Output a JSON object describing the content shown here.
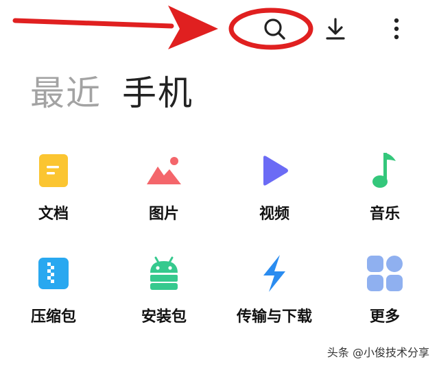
{
  "toolbar": {
    "search_icon": "search-icon",
    "download_icon": "download-icon",
    "more_icon": "more-vertical-icon"
  },
  "tabs": [
    {
      "label": "最近",
      "selected": false
    },
    {
      "label": "手机",
      "selected": true
    }
  ],
  "categories": [
    {
      "label": "文档",
      "icon": "document-icon",
      "color": "#fbc531"
    },
    {
      "label": "图片",
      "icon": "image-icon",
      "color": "#f4666b"
    },
    {
      "label": "视频",
      "icon": "video-icon",
      "color": "#6b6bf5"
    },
    {
      "label": "音乐",
      "icon": "music-icon",
      "color": "#34c77b"
    },
    {
      "label": "压缩包",
      "icon": "archive-icon",
      "color": "#29a8f0"
    },
    {
      "label": "安装包",
      "icon": "android-icon",
      "color": "#36c98e"
    },
    {
      "label": "传输与下载",
      "icon": "transfer-icon",
      "color": "#2a8cf0"
    },
    {
      "label": "更多",
      "icon": "more-grid-icon",
      "color": "#8fb0f0"
    }
  ],
  "annotation": {
    "arrow_color": "#e02020",
    "ellipse_color": "#e02020"
  },
  "watermark": "头条 @小俊技术分享"
}
